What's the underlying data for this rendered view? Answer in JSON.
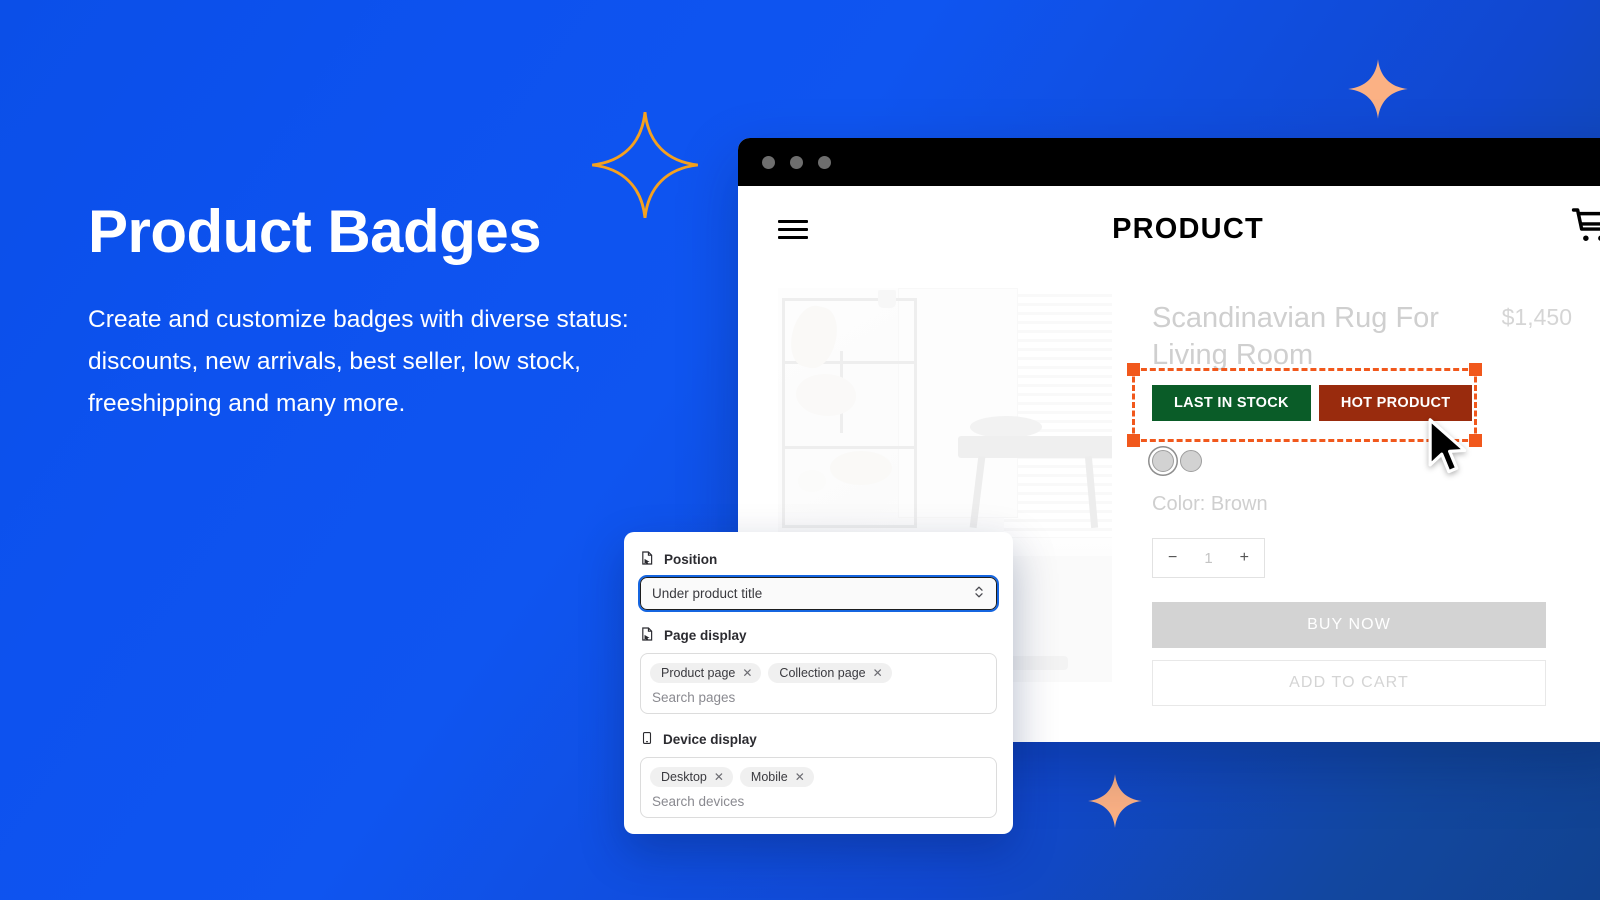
{
  "hero": {
    "title": "Product Badges",
    "subtitle": "Create and customize badges with diverse status: discounts, new arrivals, best seller, low stock, freeshipping and many more."
  },
  "browser": {
    "site_title": "PRODUCT",
    "menu_icon": "hamburger-icon",
    "cart_icon": "shopping-cart-icon"
  },
  "product": {
    "title": "Scandinavian Rug For Living Room",
    "price": "$1,450",
    "color_label": "Color: Brown",
    "quantity": "1",
    "decrement": "−",
    "increment": "+",
    "buy_now": "BUY NOW",
    "add_to_cart": "ADD TO CART",
    "badges": [
      {
        "label": "LAST IN STOCK",
        "color": "#0a5c28"
      },
      {
        "label": "HOT PRODUCT",
        "color": "#992b0d"
      }
    ],
    "selection_color": "#f1581c"
  },
  "panel": {
    "position": {
      "label": "Position",
      "icon": "page-cursor-icon",
      "value": "Under product title"
    },
    "page_display": {
      "label": "Page display",
      "icon": "page-cursor-icon",
      "tokens": [
        "Product page",
        "Collection page"
      ],
      "placeholder": "Search pages"
    },
    "device_display": {
      "label": "Device display",
      "icon": "mobile-device-icon",
      "tokens": [
        "Desktop",
        "Mobile"
      ],
      "placeholder": "Search devices"
    },
    "remove_glyph": "✕"
  },
  "decor": {
    "sparkle_outline_color": "#f5a11e",
    "sparkle_filled_color": "#fbb184"
  }
}
